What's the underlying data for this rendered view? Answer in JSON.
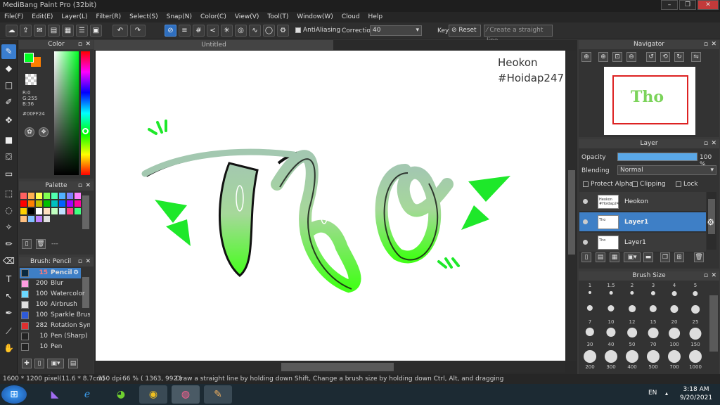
{
  "window": {
    "title": "MediBang Paint Pro (32bit)"
  },
  "menu": [
    "File(F)",
    "Edit(E)",
    "Layer(L)",
    "Filter(R)",
    "Select(S)",
    "Snap(N)",
    "Color(C)",
    "View(V)",
    "Tool(T)",
    "Window(W)",
    "Cloud",
    "Help"
  ],
  "toolbar": {
    "antialiasing_label": "AntiAliasing",
    "correction_label": "Correction",
    "correction_value": "40",
    "key_label": "Key",
    "reset_label": "Reset",
    "straight_line_label": "Create a straight line"
  },
  "color_panel": {
    "title": "Color",
    "r": "R:0",
    "g": "G:255",
    "b": "B:36",
    "hex": "#00FF24",
    "primary": "#00ff24",
    "secondary": "#ff7f00"
  },
  "palette": {
    "title": "Palette",
    "dash": "---",
    "colors": [
      "#ff6060",
      "#ffb050",
      "#ffff50",
      "#80ff50",
      "#50ffb0",
      "#50b0ff",
      "#8080ff",
      "#ff80ff",
      "#ff0000",
      "#ff8000",
      "#c0c000",
      "#00c000",
      "#00c0c0",
      "#0060ff",
      "#a000ff",
      "#ff00a0",
      "#ffd000",
      "#000000",
      "#ffffff",
      "#ffe0c0",
      "#c0ffc0",
      "#c0e0ff",
      "#ff4080",
      "#40ff80",
      "#ffc080",
      "#80c0ff",
      "#c080ff",
      "#e0e0e0"
    ]
  },
  "brush": {
    "title": "Brush: Pencil",
    "items": [
      {
        "size": "15",
        "name": "Pencil",
        "color": "#0a2a40"
      },
      {
        "size": "200",
        "name": "Blur",
        "color": "#ff9de0"
      },
      {
        "size": "100",
        "name": "Watercolor",
        "color": "#6bd8ff"
      },
      {
        "size": "100",
        "name": "Airbrush",
        "color": "#e0e0e0"
      },
      {
        "size": "100",
        "name": "Sparkle Brush",
        "color": "#2e5ad8"
      },
      {
        "size": "282",
        "name": "Rotation Sym",
        "color": "#e03030"
      },
      {
        "size": "10",
        "name": "Pen (Sharp)",
        "color": "#222222"
      },
      {
        "size": "10",
        "name": "Pen",
        "color": "#222222"
      }
    ]
  },
  "canvas": {
    "tab": "Untitled",
    "watermark_line1": "Heokon",
    "watermark_line2": "#Hoidap247",
    "art_text": "Tho"
  },
  "navigator": {
    "title": "Navigator"
  },
  "layer_panel": {
    "title": "Layer",
    "opacity_label": "Opacity",
    "opacity_value": "100 %",
    "opacity_fraction": 1.0,
    "blending_label": "Blending",
    "blending_value": "Normal",
    "protect_alpha": "Protect Alpha",
    "clipping": "Clipping",
    "lock": "Lock",
    "layers": [
      {
        "name": "Heokon",
        "thumb": "Heokon #Hoidap247"
      },
      {
        "name": "Layer1",
        "thumb": "Tho"
      },
      {
        "name": "Layer1",
        "thumb": "Tho"
      }
    ]
  },
  "brush_size": {
    "title": "Brush Size",
    "sizes": [
      "1",
      "1.5",
      "2",
      "3",
      "4",
      "5",
      "7",
      "10",
      "12",
      "15",
      "20",
      "25",
      "30",
      "40",
      "50",
      "70",
      "100",
      "150",
      "200",
      "300",
      "400",
      "500",
      "700",
      "1000"
    ]
  },
  "status": {
    "dims": "1600 * 1200 pixel",
    "cm": "(11.6 * 8.7cm)",
    "dpi": "350 dpi",
    "zoom": "66 %",
    "coords": "( 1363, 992 )",
    "hint": "Draw a straight line by holding down Shift, Change a brush size by holding down Ctrl, Alt, and dragging"
  },
  "taskbar": {
    "lang": "EN",
    "time": "3:18 AM",
    "date": "9/20/2021"
  }
}
